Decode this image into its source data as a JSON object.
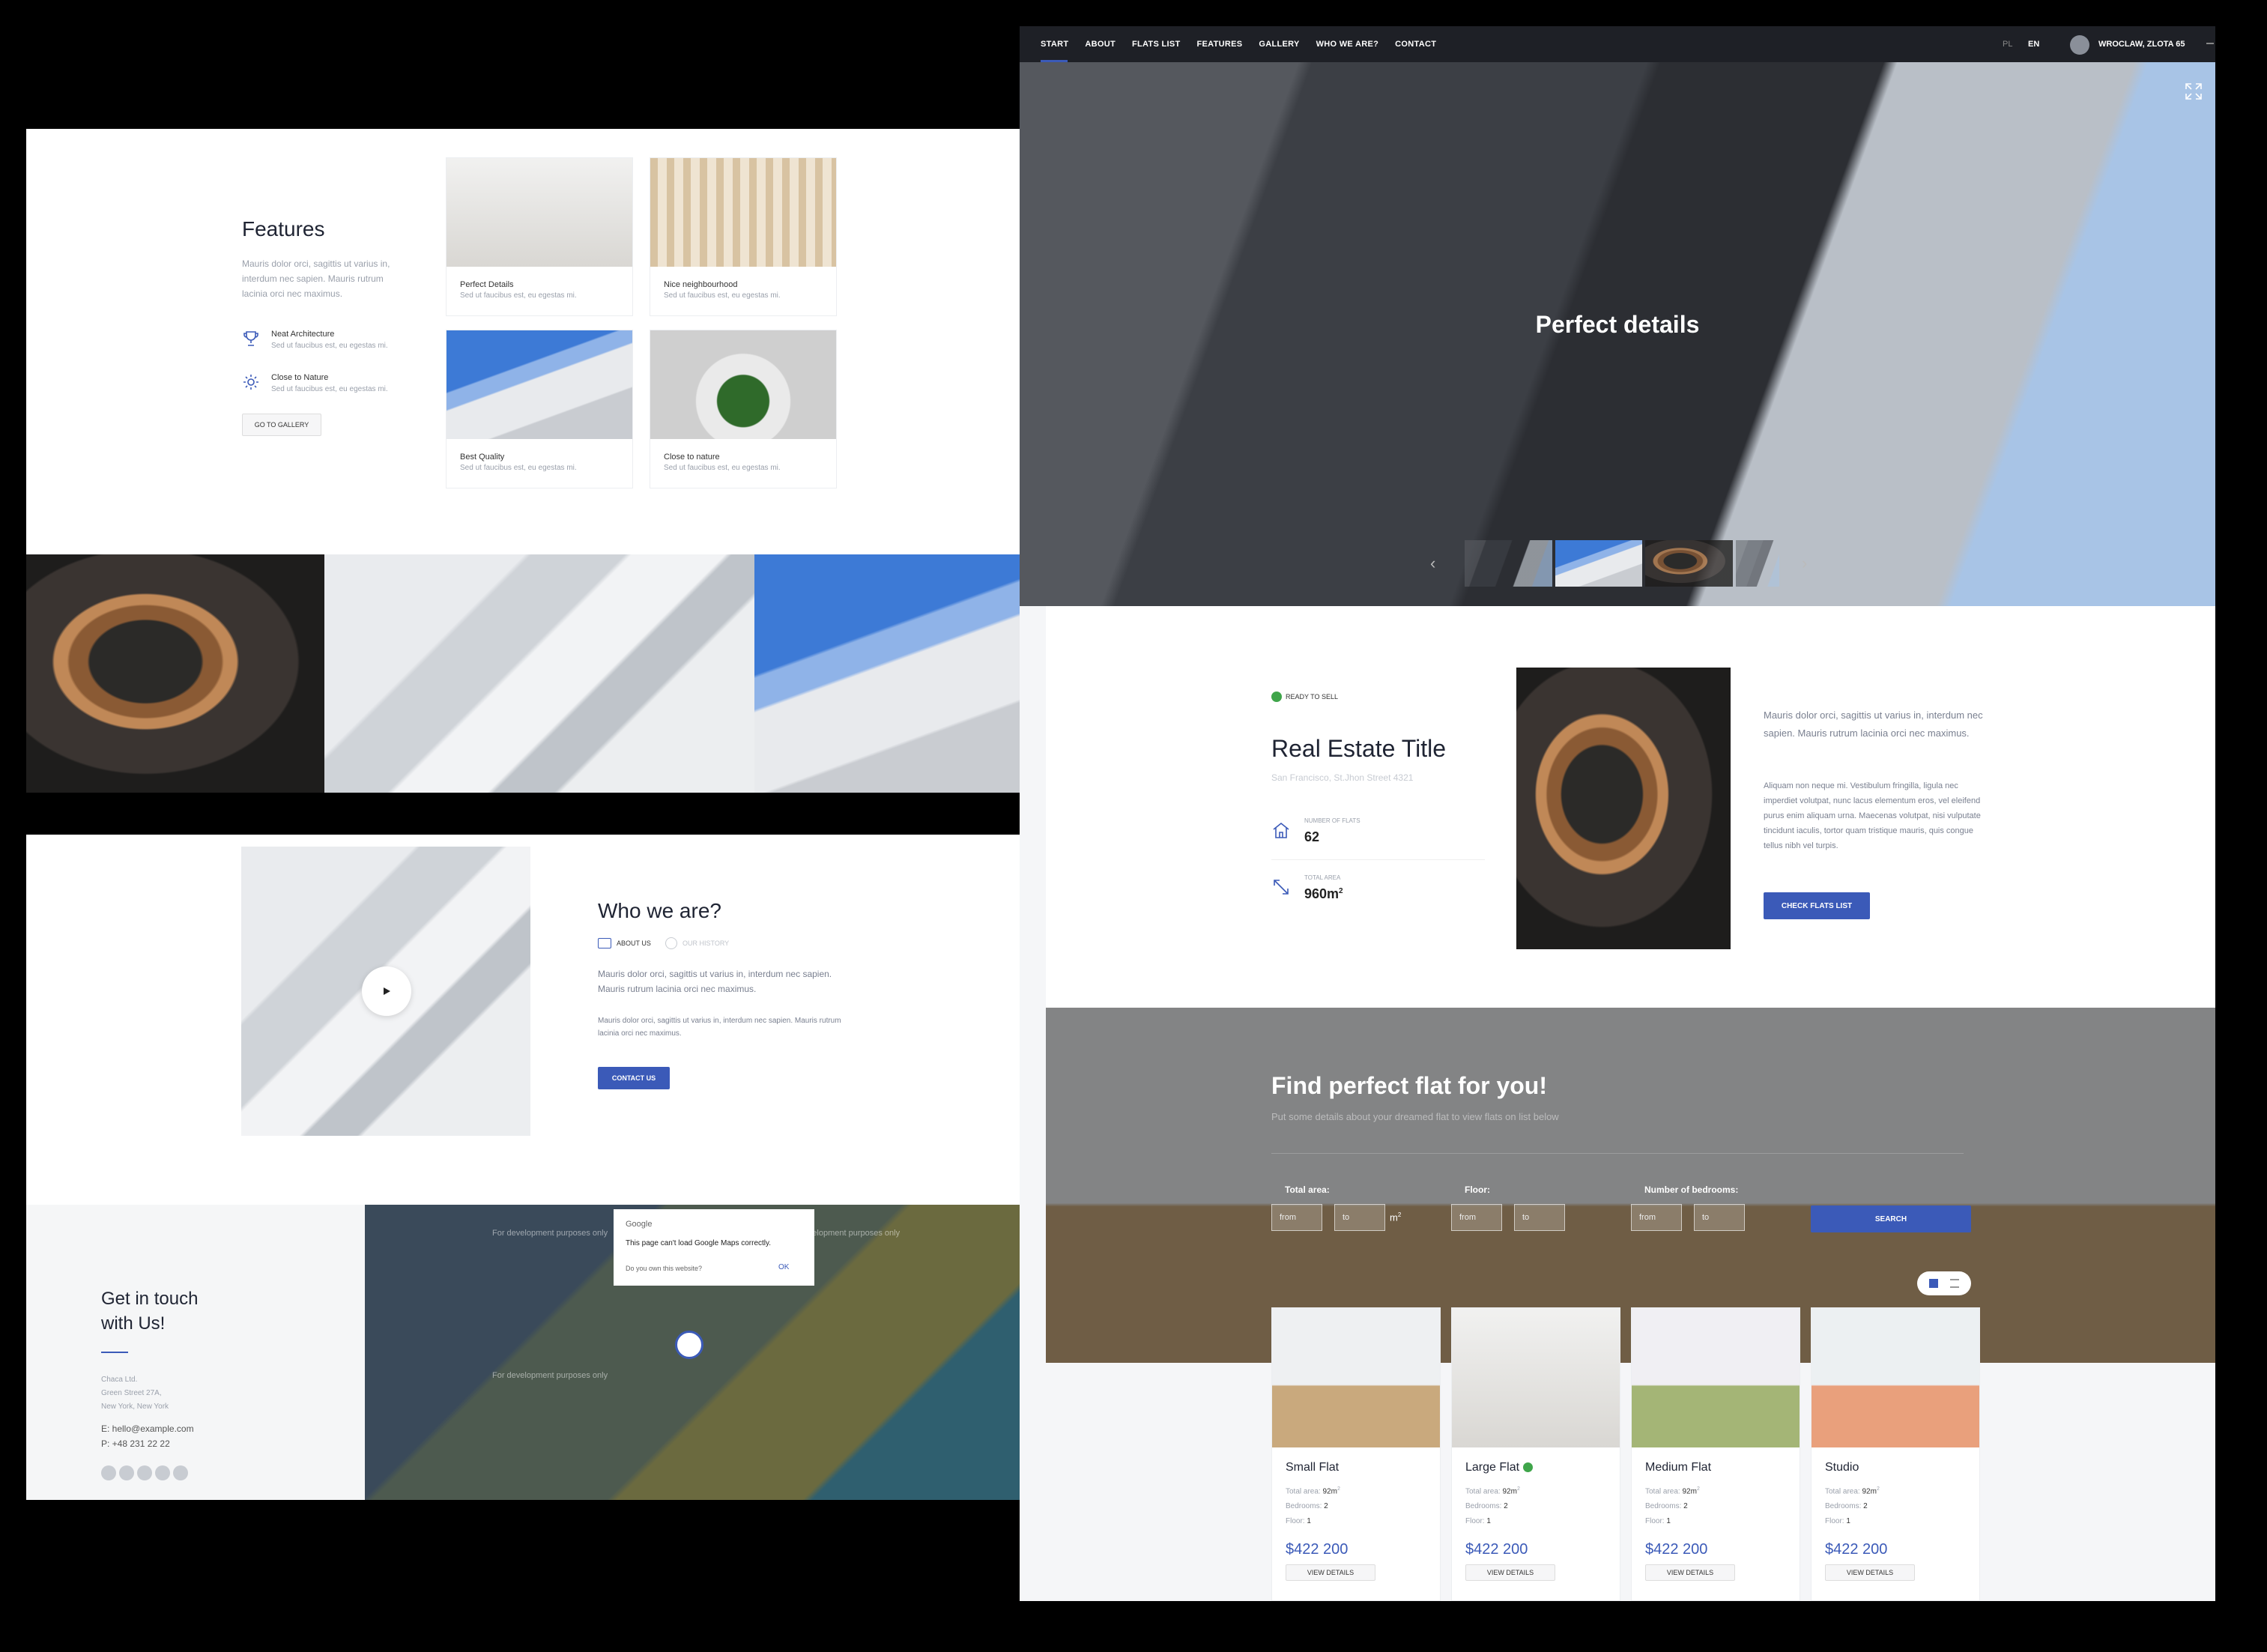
{
  "features": {
    "title": "Features",
    "desc": "Mauris dolor orci, sagittis ut varius in, interdum nec sapien. Mauris rutrum lacinia orci nec maximus.",
    "items": [
      {
        "title": "Neat Architecture",
        "sub": "Sed ut faucibus est, eu egestas mi."
      },
      {
        "title": "Close to Nature",
        "sub": "Sed ut faucibus est, eu egestas mi."
      }
    ],
    "button": "GO TO GALLERY",
    "cards": [
      {
        "title": "Perfect Details",
        "sub": "Sed ut faucibus est, eu egestas mi."
      },
      {
        "title": "Nice neighbourhood",
        "sub": "Sed ut faucibus est, eu egestas mi."
      },
      {
        "title": "Best Quality",
        "sub": "Sed ut faucibus est, eu egestas mi."
      },
      {
        "title": "Close to nature",
        "sub": "Sed ut faucibus est, eu egestas mi."
      }
    ]
  },
  "who": {
    "title": "Who we are?",
    "tabs": [
      "ABOUT US",
      "OUR HISTORY"
    ],
    "p1": "Mauris dolor orci, sagittis ut varius in, interdum nec sapien. Mauris rutrum lacinia orci nec maximus.",
    "p2": "Mauris dolor orci, sagittis ut varius in, interdum nec sapien. Mauris rutrum lacinia orci nec maximus.",
    "button": "CONTACT US"
  },
  "contact": {
    "title_1": "Get in touch",
    "title_2": "with Us!",
    "addr1": "Chaca Ltd.",
    "addr2": "Green Street 27A,",
    "addr3": "New York, New York",
    "email": "E: hello@example.com",
    "phone": "P: +48 231 22 22",
    "map_dialog_brand": "Google",
    "map_dialog_title": "This page can't load Google Maps correctly.",
    "map_dialog_q": "Do you own this website?",
    "map_dialog_ok": "OK",
    "map_watermark": "For development purposes only"
  },
  "nav": {
    "items": [
      "START",
      "ABOUT",
      "FLATS LIST",
      "FEATURES",
      "GALLERY",
      "WHO WE ARE?",
      "CONTACT"
    ],
    "lang": [
      "PL",
      "EN"
    ],
    "location": "WROCLAW, ZLOTA 65"
  },
  "hero": {
    "title": "Perfect details"
  },
  "estate": {
    "badge": "READY TO SELL",
    "title": "Real Estate Title",
    "address": "San Francisco, St.Jhon Street 4321",
    "stat1_label": "NUMBER OF FLATS",
    "stat1_value": "62",
    "stat2_label": "TOTAL AREA",
    "stat2_value": "960m",
    "stat2_sup": "2",
    "p1": "Mauris dolor orci, sagittis ut varius in, interdum nec sapien. Mauris rutrum lacinia orci nec maximus.",
    "p2": "Aliquam non neque mi. Vestibulum fringilla, ligula nec imperdiet volutpat, nunc lacus elementum eros, vel eleifend purus enim aliquam urna. Maecenas volutpat, nisi vulputate tincidunt iaculis, tortor quam tristique mauris, quis congue tellus nibh vel turpis.",
    "button": "CHECK FLATS LIST"
  },
  "search": {
    "title": "Find perfect flat for you!",
    "subtitle": "Put some details about your dreamed flat to view flats on list below",
    "area_label": "Total area:",
    "floor_label": "Floor:",
    "bed_label": "Number of bedrooms:",
    "from": "from",
    "to": "to",
    "unit": "m",
    "unit_sup": "2",
    "button": "SEARCH"
  },
  "flats": [
    {
      "name": "Small Flat",
      "area": "92m",
      "bedrooms": "2",
      "floor": "1",
      "price": "$422 200",
      "button": "VIEW DETAILS"
    },
    {
      "name": "Large Flat",
      "area": "92m",
      "bedrooms": "2",
      "floor": "1",
      "price": "$422 200",
      "button": "VIEW DETAILS"
    },
    {
      "name": "Medium Flat",
      "area": "92m",
      "bedrooms": "2",
      "floor": "1",
      "price": "$422 200",
      "button": "VIEW DETAILS"
    },
    {
      "name": "Studio",
      "area": "92m",
      "bedrooms": "2",
      "floor": "1",
      "price": "$422 200",
      "button": "VIEW DETAILS"
    }
  ],
  "flat_labels": {
    "area": "Total area:",
    "bedrooms": "Bedrooms:",
    "floor": "Floor:"
  }
}
